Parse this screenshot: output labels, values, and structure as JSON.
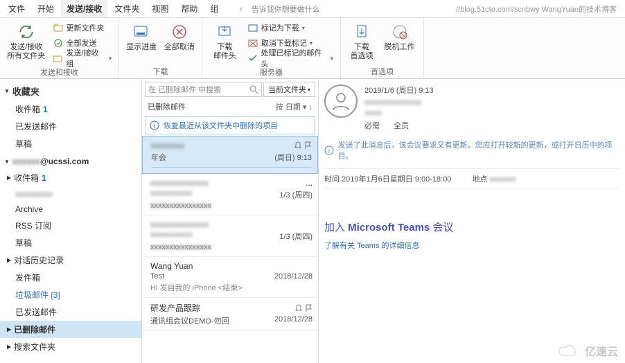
{
  "menubar": {
    "items": [
      "文件",
      "开始",
      "发送/接收",
      "文件夹",
      "视图",
      "帮助",
      "组"
    ],
    "active_index": 2,
    "tell_me": "告诉我你想要做什么",
    "url_overlay": "//blog.51cto.com/scnbwy WangYuan的技术博客"
  },
  "ribbon": {
    "groups": [
      {
        "label": "发送和接收",
        "big": "发送/接收\n所有文件夹",
        "items": [
          "更新文件夹",
          "全部发送",
          "发送/接收组"
        ]
      },
      {
        "label": "下载",
        "bigs": [
          "显示进度",
          "全部取消"
        ]
      },
      {
        "label": "服务器",
        "big": "下载\n邮件头",
        "items": [
          "标记为下载",
          "取消下载标记",
          "处理已标记的邮件头"
        ]
      },
      {
        "label": "首选项",
        "bigs": [
          "下载\n首选项",
          "脱机工作"
        ]
      }
    ]
  },
  "nav": {
    "fav_header": "收藏夹",
    "fav_items": [
      {
        "label": "收件箱",
        "count": "1"
      },
      {
        "label": "已发送邮件"
      },
      {
        "label": "草稿"
      }
    ],
    "account": "@ucssi.com",
    "folders": [
      {
        "label": "收件箱",
        "count": "1",
        "expandable": true
      },
      {
        "label": "",
        "blur": true
      },
      {
        "label": "Archive"
      },
      {
        "label": "RSS 订阅"
      },
      {
        "label": "草稿"
      },
      {
        "label": "对话历史记录",
        "expandable": true
      },
      {
        "label": "发件箱"
      },
      {
        "label": "垃圾邮件 [3]",
        "color": "#2a6fbf"
      },
      {
        "label": "已发送邮件"
      },
      {
        "label": "已删除邮件",
        "selected": true,
        "expandable": true
      },
      {
        "label": "搜索文件夹",
        "expandable": true
      }
    ]
  },
  "msglist": {
    "search_placeholder": "在 已删除邮件 中搜索",
    "scope": "当前文件夹",
    "folder_title": "已删除邮件",
    "sort_label": "按 日期",
    "recover_text": "恢复最近从该文件夹中删除的项目",
    "items": [
      {
        "subject": "年会",
        "date": "(周日) 9:13",
        "selected": true,
        "bell": true,
        "flag": true
      },
      {
        "subject": "",
        "date": "1/3 (周四)",
        "blur": true
      },
      {
        "subject": "",
        "date": "1/3 (周四)",
        "blur": true
      },
      {
        "from": "Wang Yuan",
        "subject": "Test",
        "preview": "Hi  发自我的 iPhone <结束>",
        "date": "2018/12/28"
      },
      {
        "from": "研发产品跟踪",
        "subject": "通讯组会议DEMO-勿回",
        "date": "2018/12/28",
        "bell": true,
        "flag": true
      }
    ]
  },
  "reading": {
    "date": "2019/1/6 (周日) 9:13",
    "required_label": "必需",
    "required_value": "全员",
    "info_text": "发送了此消息后，该会议要求又有更新。您应打开较新的更新，或打开日历中的项目。",
    "time_label": "时间",
    "time_value": "2019年1月6日星期日 9:00-18:00",
    "loc_label": "地点",
    "teams_join": "加入 Microsoft Teams 会议",
    "teams_more": "了解有关 Teams 的详细信息"
  },
  "watermark": "亿速云"
}
